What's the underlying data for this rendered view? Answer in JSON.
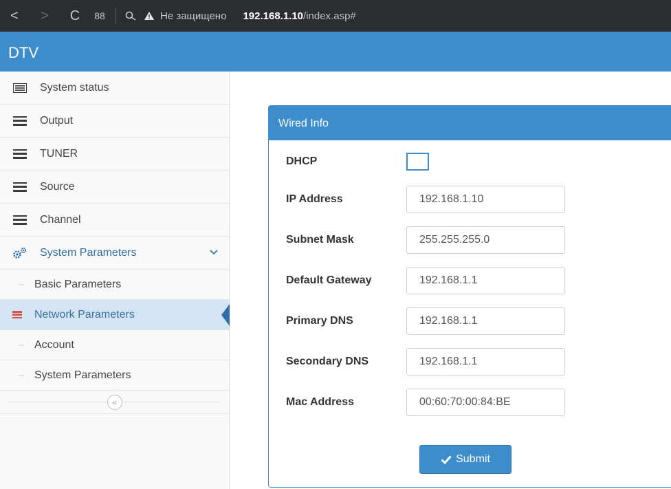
{
  "browser": {
    "back_icon": "<",
    "forward_icon": ">",
    "reload_icon": "C",
    "apps_icon": "88",
    "security_text": "Не защищено",
    "host": "192.168.1.10",
    "path": "/index.asp#"
  },
  "app": {
    "title": "DTV"
  },
  "sidebar": {
    "items": [
      {
        "label": "System status",
        "icon": "list-icon"
      },
      {
        "label": "Output",
        "icon": "menu-icon"
      },
      {
        "label": "TUNER",
        "icon": "menu-icon"
      },
      {
        "label": "Source",
        "icon": "menu-icon"
      },
      {
        "label": "Channel",
        "icon": "menu-icon"
      },
      {
        "label": "System Parameters",
        "icon": "gears-icon"
      }
    ],
    "subitems": [
      {
        "label": "Basic Parameters"
      },
      {
        "label": "Network Parameters",
        "active": true
      },
      {
        "label": "Account"
      },
      {
        "label": "System Parameters"
      }
    ],
    "collapse_icon": "«"
  },
  "panel": {
    "title": "Wired Info",
    "fields": {
      "dhcp": {
        "label": "DHCP",
        "checked": false
      },
      "ip": {
        "label": "IP Address",
        "value": "192.168.1.10"
      },
      "subnet": {
        "label": "Subnet Mask",
        "value": "255.255.255.0"
      },
      "gateway": {
        "label": "Default Gateway",
        "value": "192.168.1.1"
      },
      "dns1": {
        "label": "Primary DNS",
        "value": "192.168.1.1"
      },
      "dns2": {
        "label": "Secondary DNS",
        "value": "192.168.1.1"
      },
      "mac": {
        "label": "Mac Address",
        "value": "00:60:70:00:84:BE"
      }
    },
    "submit_label": "Submit"
  },
  "colors": {
    "accent": "#3d8ccb",
    "active_bg": "#d3e5f5",
    "active_icon": "#d9534f"
  }
}
